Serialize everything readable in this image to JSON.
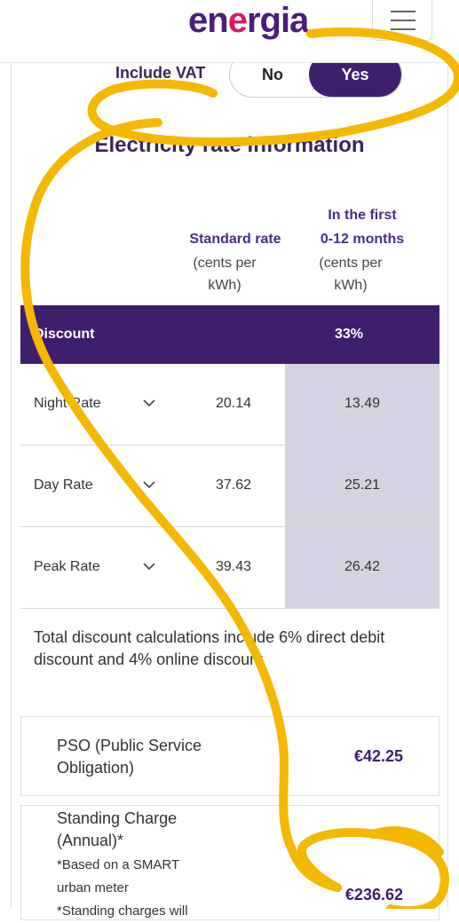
{
  "header": {
    "logo_prefix": "en",
    "logo_accent": "e",
    "logo_suffix": "rgia",
    "menu_icon": "hamburger-icon"
  },
  "vat": {
    "label": "Include VAT",
    "no": "No",
    "yes": "Yes",
    "selected": "Yes"
  },
  "section_title": "Electricity rate information",
  "columns": {
    "standard": {
      "title": "Standard rate",
      "unit_line1": "(cents per",
      "unit_line2": "kWh)"
    },
    "first": {
      "title_line1": "In the first",
      "title_line2": "0-12 months",
      "unit_line1": "(cents per",
      "unit_line2": "kWh)"
    }
  },
  "discount": {
    "label": "Discount",
    "value": "33%"
  },
  "rates": [
    {
      "name": "Night Rate",
      "standard": "20.14",
      "first": "13.49"
    },
    {
      "name": "Day Rate",
      "standard": "37.62",
      "first": "25.21"
    },
    {
      "name": "Peak Rate",
      "standard": "39.43",
      "first": "26.42"
    }
  ],
  "note": "Total discount calculations include 6% direct debit discount and 4% online discount",
  "pso": {
    "label": "PSO (Public Service Obligation)",
    "value": "€42.25"
  },
  "standing_charge": {
    "label": "Standing Charge (Annual)*",
    "note_line1": "*Based on a SMART",
    "note_line2": "urban meter",
    "note_line3": "*Standing charges will",
    "value": "€236.62"
  },
  "colors": {
    "brand_purple": "#3e1f6e",
    "brand_pink": "#d81b60",
    "highlight_column": "#d6d2e2",
    "annotation_yellow": "#f5b800"
  }
}
